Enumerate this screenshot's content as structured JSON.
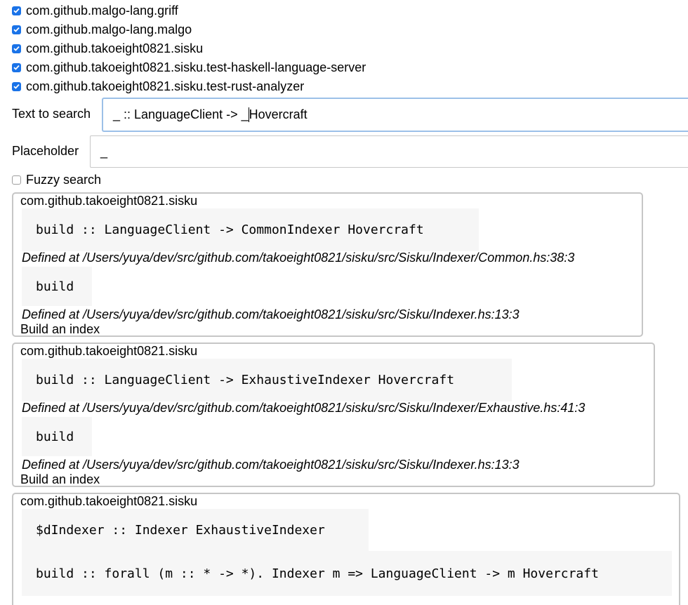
{
  "packages": [
    {
      "name": "com.github.malgo-lang.griff",
      "checked": true
    },
    {
      "name": "com.github.malgo-lang.malgo",
      "checked": true
    },
    {
      "name": "com.github.takoeight0821.sisku",
      "checked": true
    },
    {
      "name": "com.github.takoeight0821.sisku.test-haskell-language-server",
      "checked": true
    },
    {
      "name": "com.github.takoeight0821.sisku.test-rust-analyzer",
      "checked": true
    }
  ],
  "search": {
    "label": "Text to search",
    "value_before_caret": "_ :: LanguageClient -> _",
    "value_after_caret": "Hovercraft"
  },
  "placeholder": {
    "label": "Placeholder",
    "value": "_"
  },
  "fuzzy": {
    "label": "Fuzzy search",
    "checked": false
  },
  "results": [
    {
      "package": "com.github.takoeight0821.sisku",
      "signature": "build :: LanguageClient -> CommonIndexer Hovercraft",
      "defined_at": "Defined at /Users/yuya/dev/src/github.com/takoeight0821/sisku/src/Sisku/Indexer/Common.hs:38:3",
      "decl": "build",
      "decl_defined_at": "Defined at /Users/yuya/dev/src/github.com/takoeight0821/sisku/src/Sisku/Indexer.hs:13:3",
      "doc": "Build an index"
    },
    {
      "package": "com.github.takoeight0821.sisku",
      "signature": "build :: LanguageClient -> ExhaustiveIndexer Hovercraft",
      "defined_at": "Defined at /Users/yuya/dev/src/github.com/takoeight0821/sisku/src/Sisku/Indexer/Exhaustive.hs:41:3",
      "decl": "build",
      "decl_defined_at": "Defined at /Users/yuya/dev/src/github.com/takoeight0821/sisku/src/Sisku/Indexer.hs:13:3",
      "doc": "Build an index"
    },
    {
      "package": "com.github.takoeight0821.sisku",
      "signature": "$dIndexer :: Indexer ExhaustiveIndexer",
      "signature2": "build :: forall (m :: * -> *). Indexer m => LanguageClient -> m Hovercraft"
    }
  ]
}
